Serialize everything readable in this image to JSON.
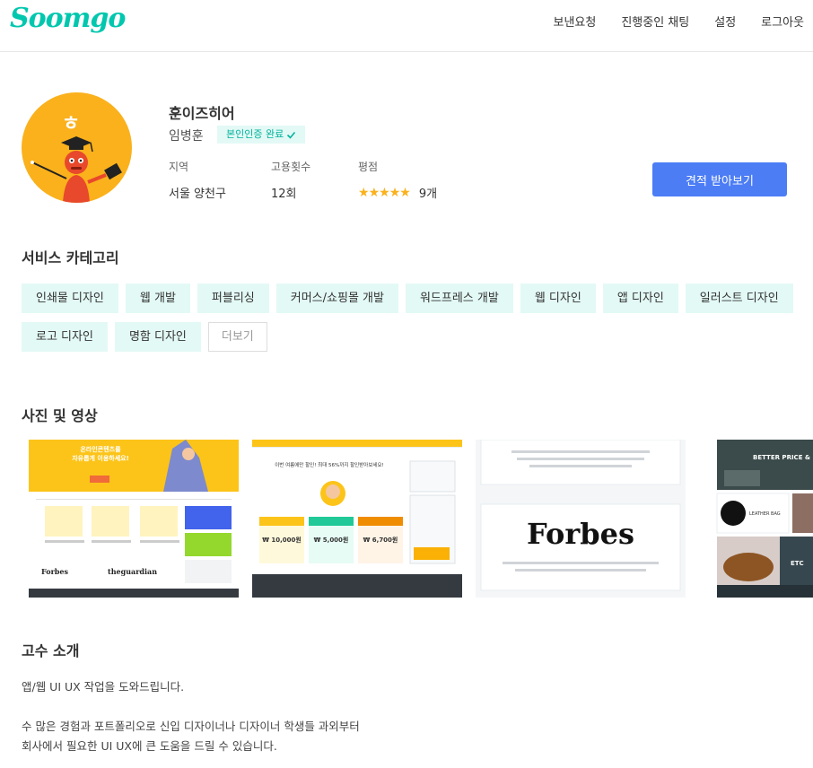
{
  "header": {
    "logo": "Soomgo",
    "nav": [
      "보낸요청",
      "진행중인 채팅",
      "설정",
      "로그아웃"
    ]
  },
  "profile": {
    "name": "훈이즈히어",
    "real_name": "임병훈",
    "verified_label": "본인인증 완료",
    "avatar_char": "ㅎ",
    "info": {
      "region_label": "지역",
      "region_value": "서울 양천구",
      "hires_label": "고용횟수",
      "hires_value": "12회",
      "rating_label": "평점",
      "rating_stars": 5,
      "rating_count": "9개"
    },
    "quote_button": "견적 받아보기"
  },
  "services": {
    "title": "서비스 카테고리",
    "categories": [
      "인쇄물 디자인",
      "웹 개발",
      "퍼블리싱",
      "커머스/쇼핑몰 개발",
      "워드프레스 개발",
      "웹 디자인",
      "앱 디자인",
      "일러스트 디자인",
      "로고 디자인",
      "명함 디자인"
    ],
    "more_label": "더보기"
  },
  "media": {
    "title": "사진 및 영상",
    "thumbs": [
      {
        "headline_1": "온라인콘텐츠를",
        "headline_2": "자유롭게 이용하세요!",
        "logos": [
          "Forbes",
          "theguardian"
        ]
      },
      {
        "headline": "이번 여름에만 할인! 최대 56%까지 할인받아보세요!",
        "prices": [
          "₩ 10,000원",
          "₩ 5,000원",
          "₩ 6,700원"
        ]
      },
      {
        "brand": "Forbes"
      },
      {
        "banner": "BETTER PRICE &",
        "product": "LEATHER BAG",
        "corner": "ETC"
      }
    ]
  },
  "about": {
    "title": "고수 소개",
    "lines": [
      "앱/웹 UI UX 작업을 도와드립니다.",
      "",
      "수 많은 경험과 포트폴리오로 신입 디자이너나 디자이너 학생들 과외부터",
      "회사에서 필요한 UI UX에 큰 도움을 드릴 수 있습니다."
    ]
  },
  "colors": {
    "brand": "#00c7ae",
    "accent_button": "#4c7df5",
    "chip_bg": "#e3f9f5",
    "star": "#fab11c"
  }
}
